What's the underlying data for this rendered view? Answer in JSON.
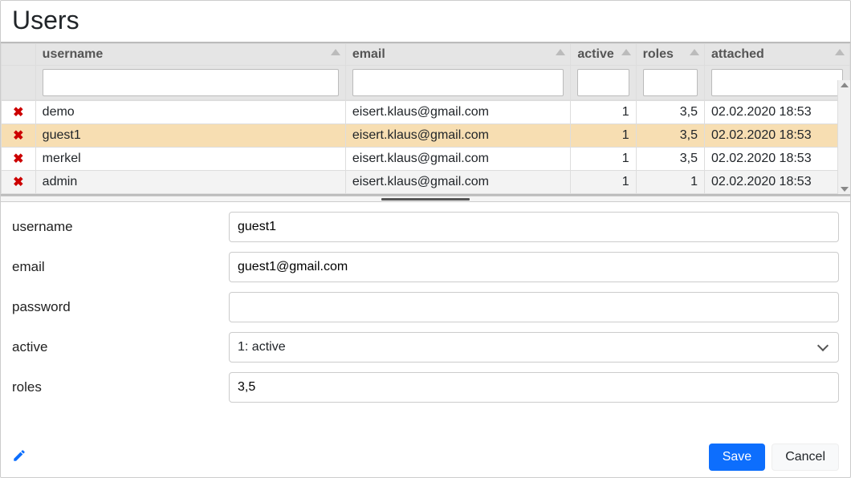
{
  "title": "Users",
  "columns": {
    "username": "username",
    "email": "email",
    "active": "active",
    "roles": "roles",
    "attached": "attached"
  },
  "filters": {
    "username": "",
    "email": "",
    "active": "",
    "roles": "",
    "attached": ""
  },
  "rows": [
    {
      "username": "demo",
      "email": "eisert.klaus@gmail.com",
      "active": "1",
      "roles": "3,5",
      "attached": "02.02.2020 18:53",
      "selected": false
    },
    {
      "username": "guest1",
      "email": "eisert.klaus@gmail.com",
      "active": "1",
      "roles": "3,5",
      "attached": "02.02.2020 18:53",
      "selected": true
    },
    {
      "username": "merkel",
      "email": "eisert.klaus@gmail.com",
      "active": "1",
      "roles": "3,5",
      "attached": "02.02.2020 18:53",
      "selected": false
    },
    {
      "username": "admin",
      "email": "eisert.klaus@gmail.com",
      "active": "1",
      "roles": "1",
      "attached": "02.02.2020 18:53",
      "selected": false
    }
  ],
  "form": {
    "labels": {
      "username": "username",
      "email": "email",
      "password": "password",
      "active": "active",
      "roles": "roles"
    },
    "values": {
      "username": "guest1",
      "email": "guest1@gmail.com",
      "password": "",
      "active": "1: active",
      "roles": "3,5"
    }
  },
  "buttons": {
    "save": "Save",
    "cancel": "Cancel"
  },
  "delete_glyph": "✖"
}
